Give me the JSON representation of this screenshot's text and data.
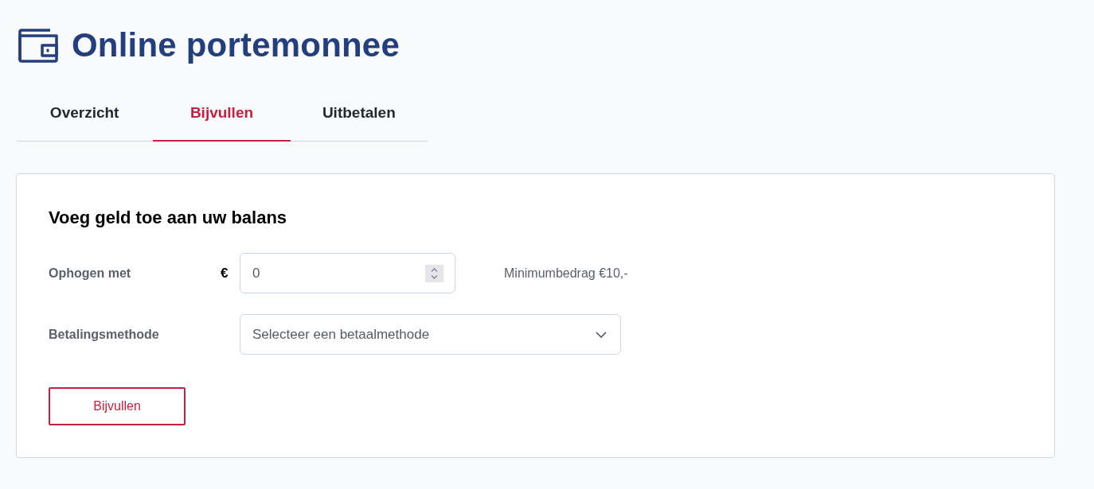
{
  "header": {
    "title": "Online portemonnee"
  },
  "tabs": [
    {
      "label": "Overzicht",
      "selected": false
    },
    {
      "label": "Bijvullen",
      "selected": true
    },
    {
      "label": "Uitbetalen",
      "selected": false
    }
  ],
  "card": {
    "title": "Voeg geld toe aan uw balans",
    "amount": {
      "label": "Ophogen met",
      "currency": "€",
      "value": "0",
      "hint": "Minimumbedrag €10,-"
    },
    "payment_method": {
      "label": "Betalingsmethode",
      "placeholder": "Selecteer een betaalmethode"
    },
    "submit_button": "Bijvullen"
  }
}
